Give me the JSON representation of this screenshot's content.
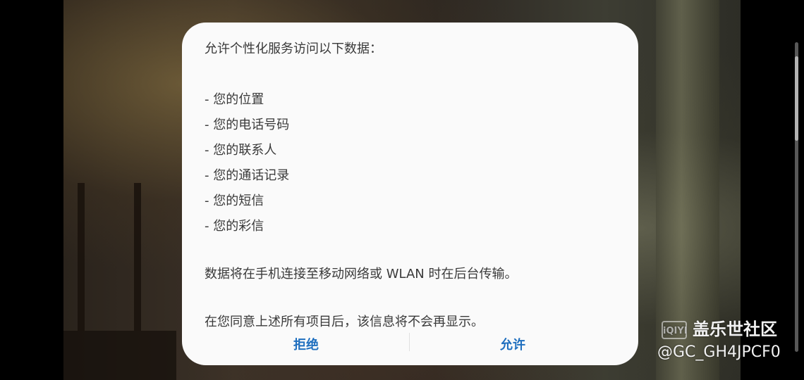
{
  "dialog": {
    "heading": "允许个性化服务访问以下数据：",
    "items": [
      "- 您的位置",
      "- 您的电话号码",
      "- 您的联系人",
      "- 您的通话记录",
      "- 您的短信",
      "- 您的彩信"
    ],
    "transmission_note": "数据将在手机连接至移动网络或 WLAN 时在后台传输。",
    "agreement_note": "在您同意上述所有项目后，该信息将不会再显示。",
    "deny_label": "拒绝",
    "allow_label": "允许"
  },
  "watermark": {
    "logo_text": "iQIYI",
    "site_name": "盖乐世社区",
    "username": "@GC_GH4JPCF0"
  },
  "colors": {
    "dialog_background": "#fafafa",
    "body_text": "#3a3a3a",
    "action_text": "#1f6fbf"
  }
}
